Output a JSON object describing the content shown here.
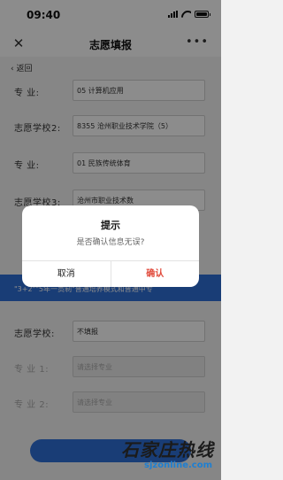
{
  "status_bar": {
    "time": "09:40"
  },
  "title_bar": {
    "close_icon": "close-icon",
    "title": "志愿填报",
    "more_icon": "more-icon"
  },
  "back": {
    "label": "返回"
  },
  "form": {
    "rows": [
      {
        "label": "专  业:",
        "value": "05 计算机应用"
      },
      {
        "label": "志愿学校2:",
        "value": "8355 沧州职业技术学院（5）"
      },
      {
        "label": "专  业:",
        "value": "01 民族传统体育"
      },
      {
        "label": "志愿学校3:",
        "value": "沧州市职业技术数"
      }
    ],
    "notice": "\"3+2\"\"5年一贯制\"普通培养模式和普通中专",
    "lower_rows": [
      {
        "label": "志愿学校:",
        "value": "不填报"
      },
      {
        "label": "专  业  1:",
        "value": "请选择专业"
      },
      {
        "label": "专  业  2:",
        "value": "请选择专业"
      }
    ]
  },
  "dialog": {
    "title": "提示",
    "message": "是否确认信息无误?",
    "cancel": "取消",
    "confirm": "确认"
  },
  "watermark": {
    "chinese": "石家庄热线",
    "domain": "sjzonline.com"
  },
  "colors": {
    "accent_blue": "#2f6fd8",
    "confirm_red": "#e14a3b",
    "overlay": "rgba(0,0,0,0.45)"
  }
}
